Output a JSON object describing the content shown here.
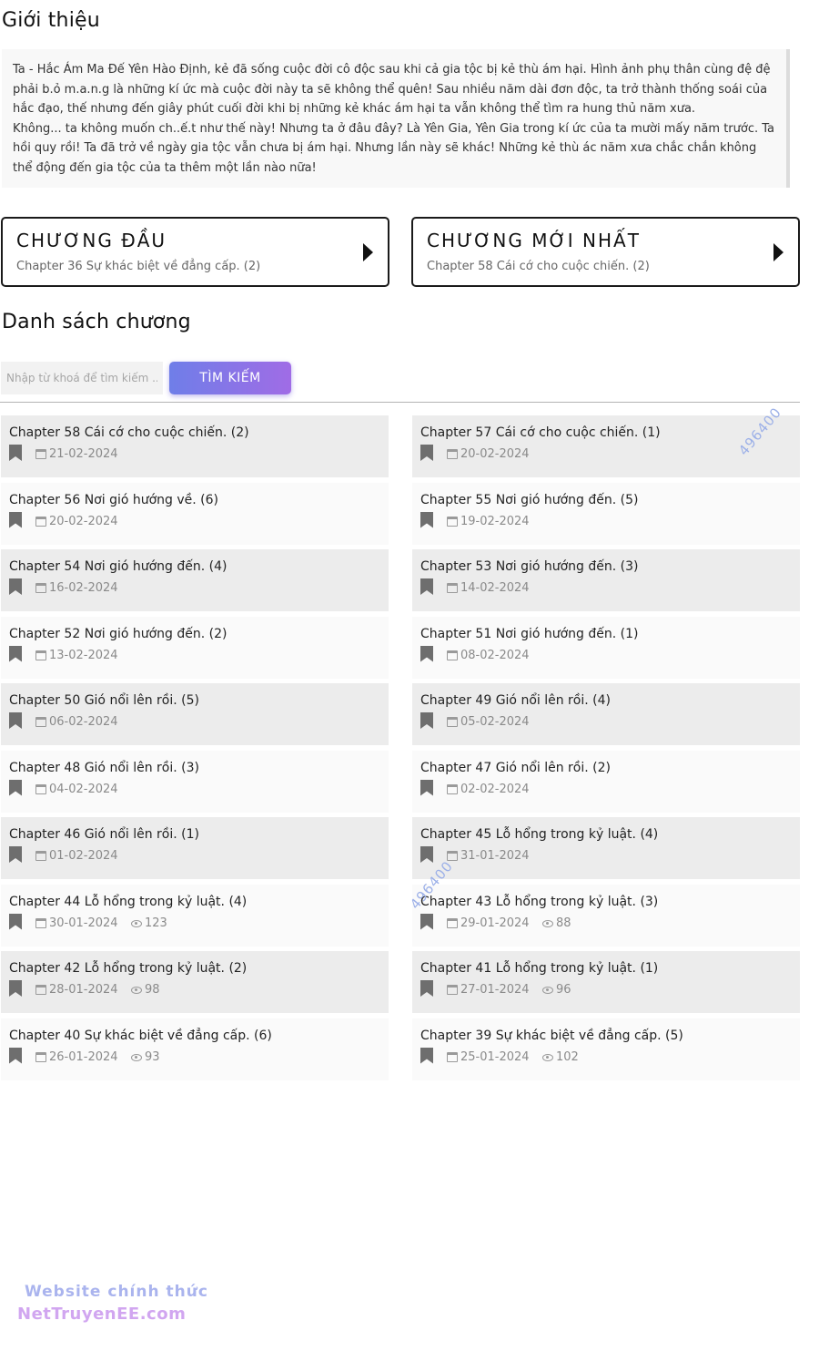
{
  "intro": {
    "heading": "Giới thiệu",
    "paragraph1": "Ta - Hắc Ám Ma Đế Yên Hào Định, kẻ đã sống cuộc đời cô độc sau khi cả gia tộc bị kẻ thù ám hại. Hình ảnh phụ thân cùng đệ đệ phải b.ỏ m.a.n.g là những kí ức mà cuộc đời này ta sẽ không thể quên! Sau nhiều năm dài đơn độc, ta trở thành thống soái của hắc đạo, thế nhưng đến giây phút cuối đời khi bị những kẻ khác ám hại ta vẫn không thể tìm ra hung thủ năm xưa.",
    "paragraph2": "Không... ta không muốn ch..ế.t như thế này! Nhưng ta ở đâu đây? Là Yên Gia, Yên Gia trong kí ức của ta mười mấy năm trước. Ta hồi quy rồi! Ta đã trở về ngày gia tộc vẫn chưa bị ám hại. Nhưng lần này sẽ khác! Những kẻ thù ác năm xưa chắc chắn không thể động đến gia tộc của ta thêm một lần nào nữa!"
  },
  "first_chapter": {
    "title": "CHƯƠNG ĐẦU",
    "subtitle": "Chapter 36 Sự khác biệt về đẳng cấp. (2)",
    "icon": "play-arrow-icon"
  },
  "latest_chapter": {
    "title": "CHƯƠNG MỚI NHẤT",
    "subtitle": "Chapter 58 Cái cớ cho cuộc chiến. (2)",
    "icon": "play-arrow-icon"
  },
  "chapter_list": {
    "heading": "Danh sách chương",
    "search": {
      "placeholder": "Nhập từ khoá để tìm kiếm ...",
      "value": "",
      "button_label": "TÌM KIẾM"
    },
    "chapters": [
      {
        "title": "Chapter 58 Cái cớ cho cuộc chiến. (2)",
        "date": "21-02-2024",
        "views": ""
      },
      {
        "title": "Chapter 57 Cái cớ cho cuộc chiến. (1)",
        "date": "20-02-2024",
        "views": ""
      },
      {
        "title": "Chapter 56 Nơi gió hướng về. (6)",
        "date": "20-02-2024",
        "views": ""
      },
      {
        "title": "Chapter 55 Nơi gió hướng đến. (5)",
        "date": "19-02-2024",
        "views": ""
      },
      {
        "title": "Chapter 54 Nơi gió hướng đến. (4)",
        "date": "16-02-2024",
        "views": ""
      },
      {
        "title": "Chapter 53 Nơi gió hướng đến. (3)",
        "date": "14-02-2024",
        "views": ""
      },
      {
        "title": "Chapter 52 Nơi gió hướng đến. (2)",
        "date": "13-02-2024",
        "views": ""
      },
      {
        "title": "Chapter 51 Nơi gió hướng đến. (1)",
        "date": "08-02-2024",
        "views": ""
      },
      {
        "title": "Chapter 50 Gió nổi lên rồi. (5)",
        "date": "06-02-2024",
        "views": ""
      },
      {
        "title": "Chapter 49 Gió nổi lên rồi. (4)",
        "date": "05-02-2024",
        "views": ""
      },
      {
        "title": "Chapter 48 Gió nổi lên rồi. (3)",
        "date": "04-02-2024",
        "views": ""
      },
      {
        "title": "Chapter 47 Gió nổi lên rồi. (2)",
        "date": "02-02-2024",
        "views": ""
      },
      {
        "title": "Chapter 46 Gió nổi lên rồi. (1)",
        "date": "01-02-2024",
        "views": ""
      },
      {
        "title": "Chapter 45 Lỗ hổng trong kỷ luật. (4)",
        "date": "31-01-2024",
        "views": ""
      },
      {
        "title": "Chapter 44 Lỗ hổng trong kỷ luật. (4)",
        "date": "30-01-2024",
        "views": "123"
      },
      {
        "title": "Chapter 43 Lỗ hổng trong kỷ luật. (3)",
        "date": "29-01-2024",
        "views": "88"
      },
      {
        "title": "Chapter 42 Lỗ hổng trong kỷ luật. (2)",
        "date": "28-01-2024",
        "views": "98"
      },
      {
        "title": "Chapter 41 Lỗ hổng trong kỷ luật. (1)",
        "date": "27-01-2024",
        "views": "96"
      },
      {
        "title": "Chapter 40 Sự khác biệt về đẳng cấp. (6)",
        "date": "26-01-2024",
        "views": "93"
      },
      {
        "title": "Chapter 39 Sự khác biệt về đẳng cấp. (5)",
        "date": "25-01-2024",
        "views": "102"
      }
    ]
  },
  "watermarks": [
    "496400",
    "496400"
  ],
  "footer": {
    "line1": "Website chính thức",
    "line2": "NetTruyenEE.com"
  },
  "colors": {
    "button_gradient_start": "#6f7ee8",
    "button_gradient_end": "#a06ce6",
    "row_shade": "#ececec",
    "watermark": "#9cb0e8"
  }
}
